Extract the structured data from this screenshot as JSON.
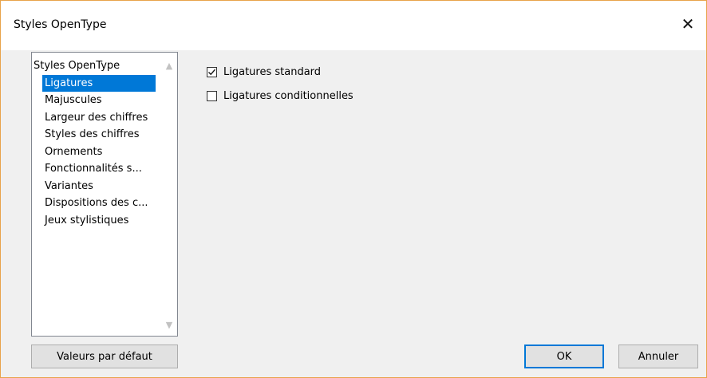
{
  "window": {
    "title": "Styles OpenType",
    "close_glyph": "✕"
  },
  "list": {
    "items": [
      {
        "label": "Styles OpenType",
        "header": true
      },
      {
        "label": "Ligatures",
        "selected": true
      },
      {
        "label": "Majuscules"
      },
      {
        "label": "Largeur des chiffres"
      },
      {
        "label": "Styles des chiffres"
      },
      {
        "label": "Ornements"
      },
      {
        "label": "Fonctionnalités s..."
      },
      {
        "label": "Variantes"
      },
      {
        "label": "Dispositions des c..."
      },
      {
        "label": "Jeux stylistiques"
      }
    ],
    "scroll_up_glyph": "▲",
    "scroll_down_glyph": "▼"
  },
  "options": [
    {
      "label": "Ligatures standard",
      "checked": true
    },
    {
      "label": "Ligatures conditionnelles",
      "checked": false
    }
  ],
  "buttons": {
    "defaults": "Valeurs par défaut",
    "ok": "OK",
    "cancel": "Annuler"
  },
  "colors": {
    "selection": "#0078d7",
    "window_border": "#e8a34a",
    "dialog_bg": "#f0f0f0"
  }
}
